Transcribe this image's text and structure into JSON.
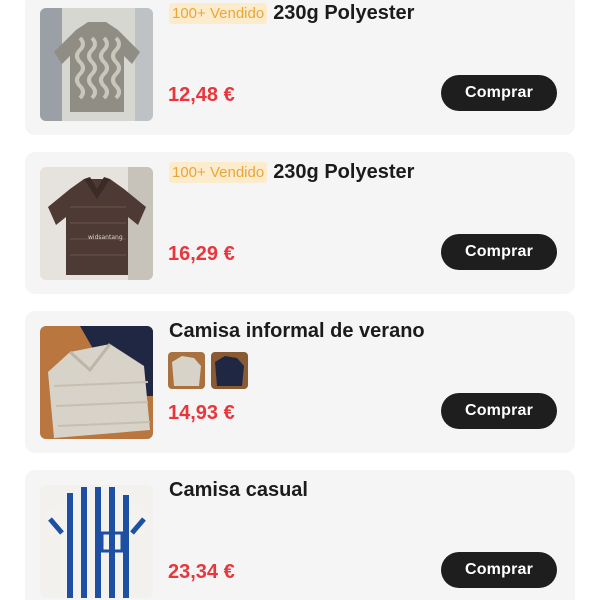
{
  "products": [
    {
      "badge": "100+ Vendido",
      "title": "230g Polyester",
      "price": "12,48 €",
      "buy_label": "Comprar",
      "image_icon": "grey-wavy-knit-shirt-photo"
    },
    {
      "badge": "100+ Vendido",
      "title": "230g Polyester",
      "price": "16,29 €",
      "buy_label": "Comprar",
      "image_icon": "brown-knit-polo-shirt-photo"
    },
    {
      "title": "Camisa informal de verano",
      "price": "14,93 €",
      "buy_label": "Comprar",
      "image_icon": "beige-and-navy-shirts-photo",
      "swatches": [
        "beige-swatch",
        "navy-swatch"
      ]
    },
    {
      "title": "Camisa casual",
      "price": "23,34 €",
      "buy_label": "Comprar",
      "image_icon": "blue-striped-crochet-shirt-photo"
    }
  ],
  "colors": {
    "card_bg": "#f5f5f5",
    "price": "#e8363c",
    "badge_text": "#e9a53a",
    "badge_bg": "#fdeccc",
    "button_bg": "#1e1e1e"
  }
}
